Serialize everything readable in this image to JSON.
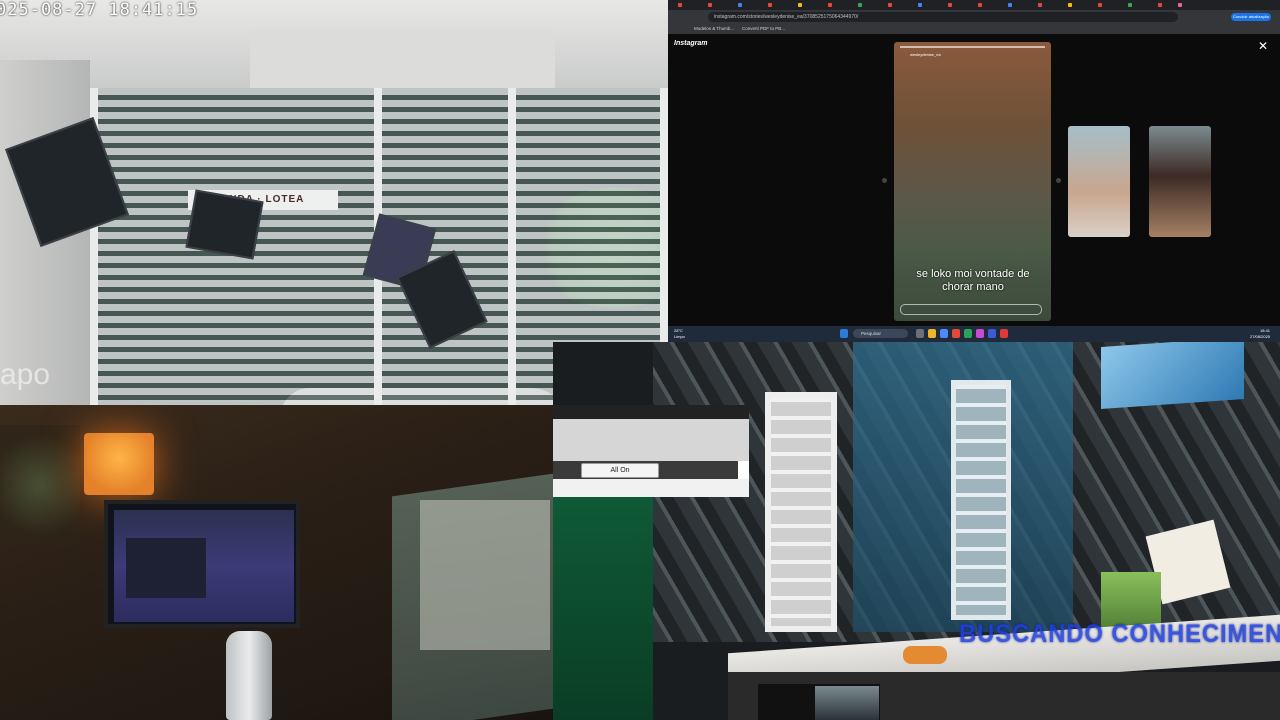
{
  "cameras": {
    "gate": {
      "timestamp": "025-08-27 18:41:15",
      "brand": "apo",
      "shop_sign": "ENDA · LOTEA"
    },
    "studio": {
      "overlay_text": "BUSCANDO CONHECIMENTO"
    }
  },
  "screen_share": {
    "address": "instagram.com/stories/wesleydenise_ea/3708525175064344970/",
    "sync_button": "Concluir atualização",
    "bookmarks": [
      "Modelos & Thumb...",
      "Converti PDF to PB..."
    ],
    "instagram": {
      "logo": "Instagram",
      "close_icon": "close-icon",
      "story_user": "wesleydenise_ea",
      "story_caption": "se loko moi vontade de chorar mano"
    },
    "taskbar": {
      "weather_temp": "28°C",
      "weather_desc": "Limpo",
      "search_placeholder": "Pesquisar",
      "time": "18:41",
      "date": "27/08/2025"
    }
  },
  "popup": {
    "all_on_label": "All On"
  },
  "colors": {
    "overlay_blue": "#1e3fe0",
    "lamp_orange": "#ffb547",
    "instagram_bg": "#0b0b0b"
  }
}
